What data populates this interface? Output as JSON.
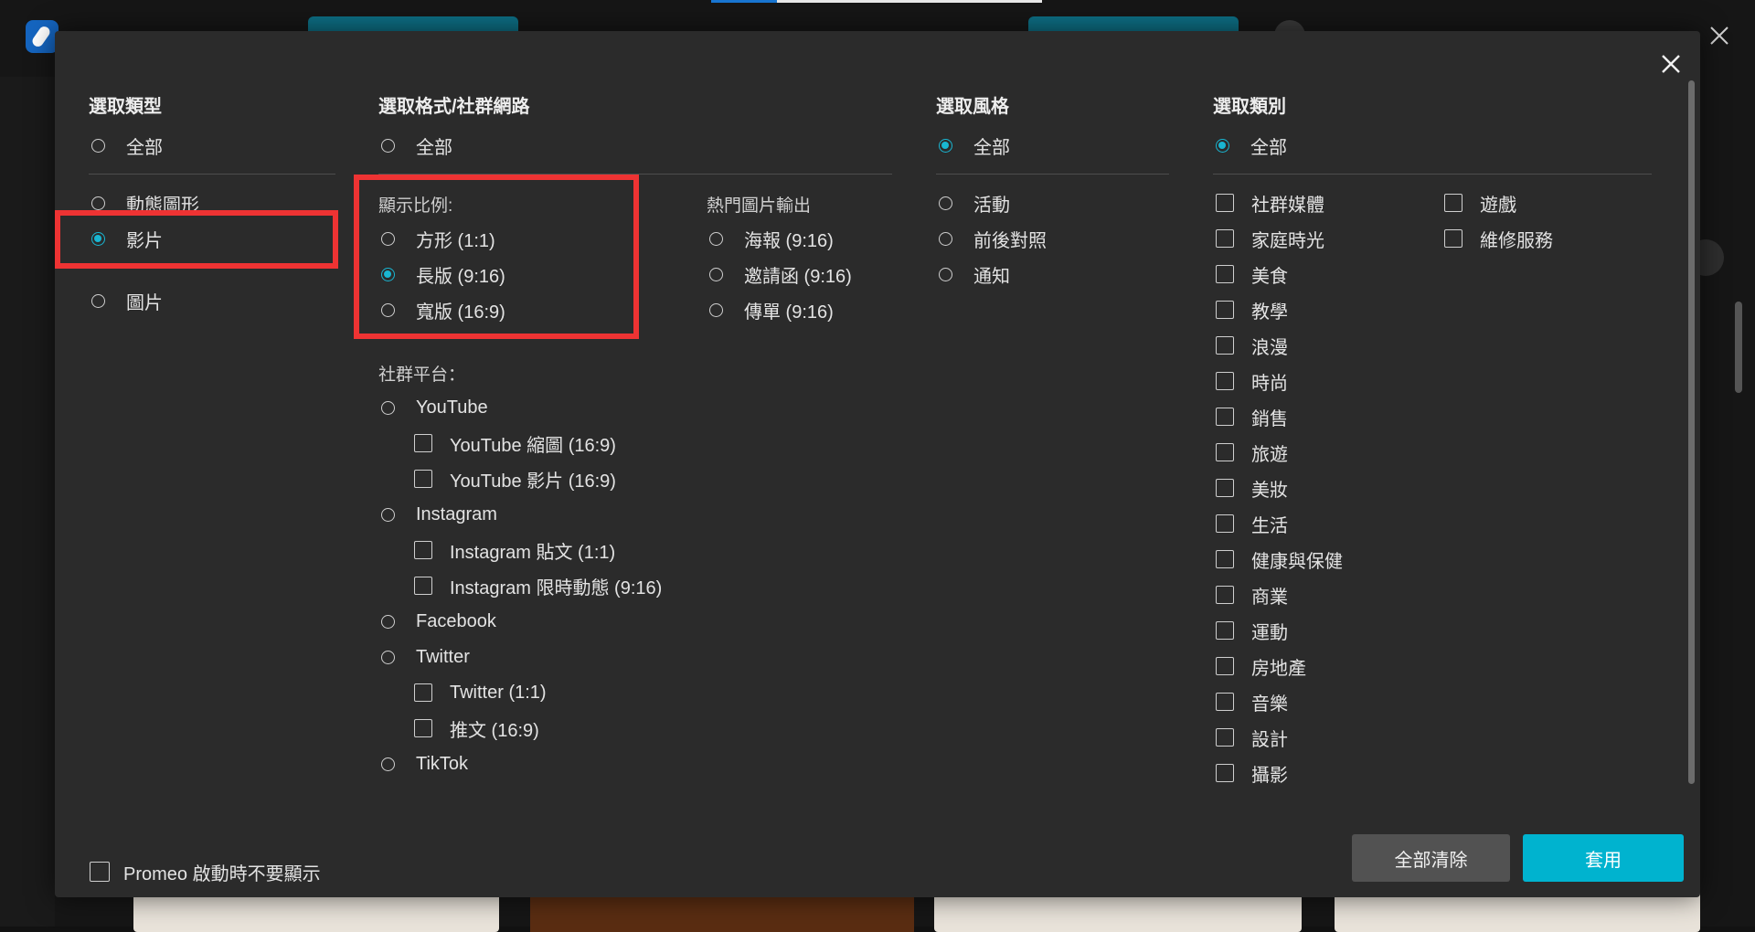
{
  "colors": {
    "accent": "#19b6d2",
    "highlight": "#ee3333",
    "dialog_bg": "#2b2b2b",
    "apply_button": "#00b3cf"
  },
  "type_section": {
    "title": "選取類型",
    "all": "全部",
    "options": [
      "動態圖形",
      "影片",
      "圖片"
    ],
    "selected": "影片"
  },
  "format_section": {
    "title": "選取格式/社群網路",
    "all": "全部",
    "ratio_label": "顯示比例:",
    "ratios": [
      "方形 (1:1)",
      "長版 (9:16)",
      "寬版 (16:9)"
    ],
    "selected_ratio": "長版 (9:16)",
    "popular_label": "熱門圖片輸出",
    "popular": [
      "海報 (9:16)",
      "邀請函 (9:16)",
      "傳單 (9:16)"
    ],
    "social_label": "社群平台：",
    "youtube": "YouTube",
    "youtube_thumb": "YouTube 縮圖 (16:9)",
    "youtube_video": "YouTube 影片 (16:9)",
    "instagram": "Instagram",
    "instagram_post": "Instagram 貼文 (1:1)",
    "instagram_story": "Instagram 限時動態 (9:16)",
    "facebook": "Facebook",
    "twitter": "Twitter",
    "twitter_square": "Twitter (1:1)",
    "twitter_tweet": "推文 (16:9)",
    "tiktok": "TikTok"
  },
  "style_section": {
    "title": "選取風格",
    "all": "全部",
    "options": [
      "活動",
      "前後對照",
      "通知"
    ]
  },
  "category_section": {
    "title": "選取類別",
    "all": "全部",
    "col1": [
      "社群媒體",
      "家庭時光",
      "美食",
      "教學",
      "浪漫",
      "時尚",
      "銷售",
      "旅遊",
      "美妝",
      "生活",
      "健康與保健",
      "商業",
      "運動",
      "房地產",
      "音樂",
      "設計",
      "攝影"
    ],
    "col2": [
      "遊戲",
      "維修服務"
    ]
  },
  "footer": {
    "dont_show_label": "Promeo 啟動時不要顯示",
    "clear_all": "全部清除",
    "apply": "套用"
  }
}
